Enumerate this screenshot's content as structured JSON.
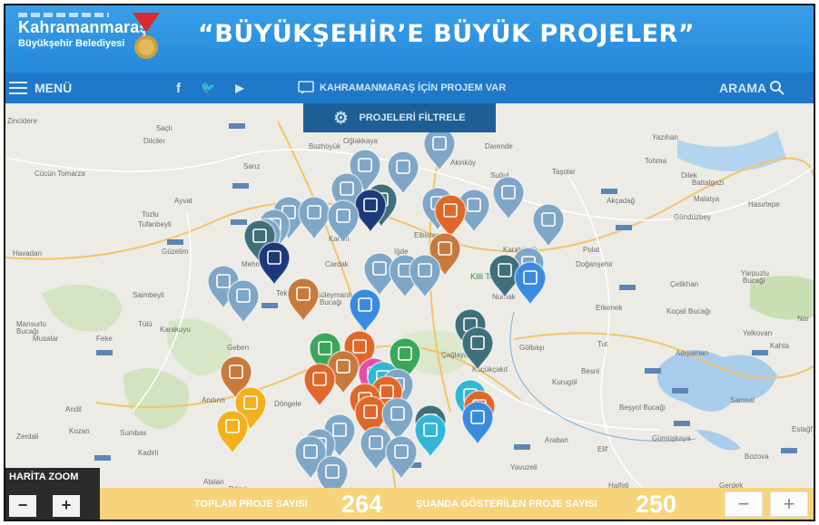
{
  "header": {
    "logo_line1": "Kahramanmaraş",
    "logo_line2": "Büyükşehir Belediyesi",
    "title": "“BÜYÜKŞEHİR’E BÜYÜK PROJELER”"
  },
  "nav": {
    "menu": "MENÜ",
    "social": [
      "f",
      "🐦",
      "▶"
    ],
    "project_link": "KAHRAMANMARAŞ İÇİN PROJEM VAR",
    "search": "ARAMA"
  },
  "filter": {
    "label": "PROJELERİ FİLTRELE"
  },
  "map": {
    "places": [
      "Zincidere",
      "Saçlı",
      "Dilciler",
      "Cücün Tomarza",
      "Sarız",
      "Ayvat",
      "Tozlu Tufanbeyli",
      "Güzelim",
      "Havadan",
      "Mehmetbey",
      "Saimbeyli",
      "Mansurlu Bucağı",
      "Musalar",
      "Feke",
      "Tülü",
      "Karakuyu",
      "Geben",
      "Andırın",
      "Andil",
      "Döngele",
      "Zerdali",
      "Kozan",
      "Sumbas",
      "Kadirli",
      "Atalan",
      "Dönci",
      "Bozhöyük",
      "Oğlakkaya",
      "Darende",
      "Akinköy",
      "Suğul",
      "Taşolar",
      "Tohma",
      "Yazıhan",
      "Dilek Battalgazi",
      "Malatya",
      "Hasırtepe",
      "Akçadağ",
      "Gündüzbey",
      "Elbistan",
      "İğde",
      "Kandil",
      "Cardak",
      "Tekir",
      "Süleymanlı Bucağı",
      "Karahüyük",
      "Polat",
      "Doğanşehir",
      "Killi Tepe",
      "Nurhak",
      "Erkenek",
      "Çelikhan",
      "Yarpuzlu Bucağı",
      "Koçali Bucağı",
      "Yelkovan",
      "Nar Narince",
      "Kahta",
      "Adıyaman",
      "Tut",
      "Gölbaşı",
      "Besni",
      "Kurugöl",
      "Beşyol Bucağı",
      "Samsat",
      "Çağlayancerit",
      "Küçükçakıt",
      "Gümüşkaya",
      "Araban",
      "Bozova",
      "Yavuzeli",
      "Halfeti",
      "Gerdek",
      "Estağfi",
      "Elif"
    ],
    "green_label": "Killi Tepe"
  },
  "stats": {
    "total_label": "TOPLAM PROJE SAYISI",
    "total_value": "264",
    "shown_label": "ŞUANDA GÖSTERİLEN PROJE SAYISI",
    "shown_value": "250"
  },
  "zoom": {
    "label": "HARİTA ZOOM",
    "minus": "−",
    "plus": "+"
  },
  "colors": {
    "header": "#2f94e2",
    "nav": "#1f78c8",
    "bottom_bar": "#f7d37c",
    "pin_blue_grey": "#7fa6c6",
    "pin_teal": "#3f6f7a",
    "pin_orange": "#e0672a",
    "pin_blue": "#3a8be0"
  }
}
